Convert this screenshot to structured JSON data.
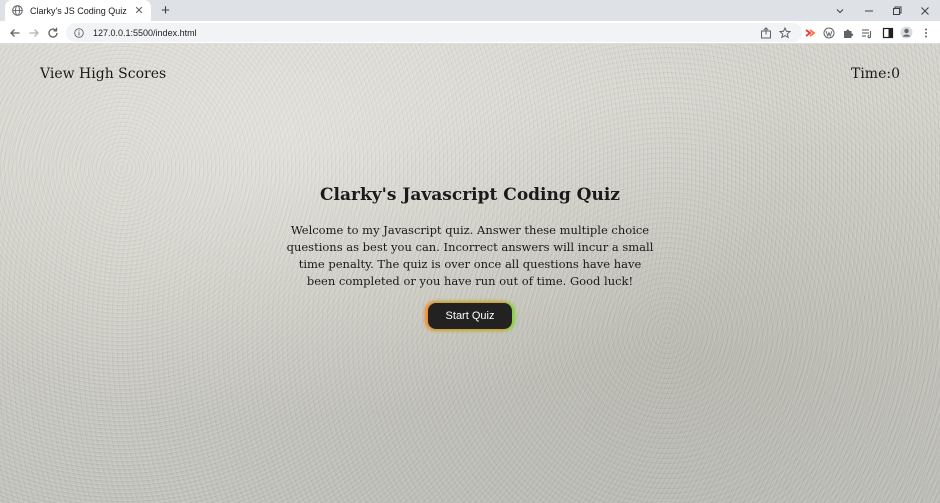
{
  "browser": {
    "tab": {
      "title": "Clarky's JS Coding Quiz",
      "close_glyph": "✕",
      "favicon": "globe-icon"
    },
    "new_tab_glyph": "+",
    "window_controls": [
      "chevron-down-icon",
      "minimize-icon",
      "restore-icon",
      "close-icon"
    ],
    "address": {
      "url": "127.0.0.1:5500/index.html",
      "icon": "info-icon"
    },
    "toolbar_icons": [
      "share-icon",
      "star-icon",
      "extension-red-icon",
      "wordpress-icon",
      "puzzle-icon",
      "sidepanel-icon",
      "profile-icon",
      "more-icon"
    ]
  },
  "header": {
    "high_scores_label": "View High Scores",
    "timer_label": "Time:",
    "timer_value": "0"
  },
  "main": {
    "title": "Clarky's Javascript Coding Quiz",
    "description": "Welcome to my Javascript quiz. Answer these multiple choice questions as best you can. Incorrect answers will incur a small time penalty. The quiz is over once all questions have have been completed or you have run out of time. Good luck!",
    "start_button_label": "Start Quiz"
  },
  "colors": {
    "button_bg": "#222222",
    "button_glow_left": "#f28a2e",
    "button_glow_right": "#7bdc4a",
    "page_bg": "#d3d2ca"
  }
}
